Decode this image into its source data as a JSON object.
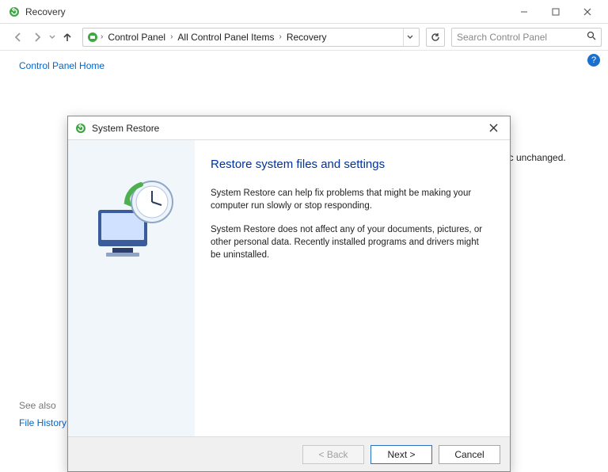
{
  "window": {
    "title": "Recovery"
  },
  "nav": {
    "crumbs": [
      "Control Panel",
      "All Control Panel Items",
      "Recovery"
    ],
    "search_placeholder": "Search Control Panel"
  },
  "sidebar": {
    "home_link": "Control Panel Home"
  },
  "content": {
    "trail_text": "ic unchanged."
  },
  "help": {
    "badge": "?"
  },
  "seealso": {
    "title": "See also",
    "links": [
      "File History"
    ]
  },
  "dialog": {
    "title": "System Restore",
    "heading": "Restore system files and settings",
    "paragraph1": "System Restore can help fix problems that might be making your computer run slowly or stop responding.",
    "paragraph2": "System Restore does not affect any of your documents, pictures, or other personal data. Recently installed programs and drivers might be uninstalled.",
    "buttons": {
      "back": "< Back",
      "next": "Next >",
      "cancel": "Cancel"
    }
  }
}
